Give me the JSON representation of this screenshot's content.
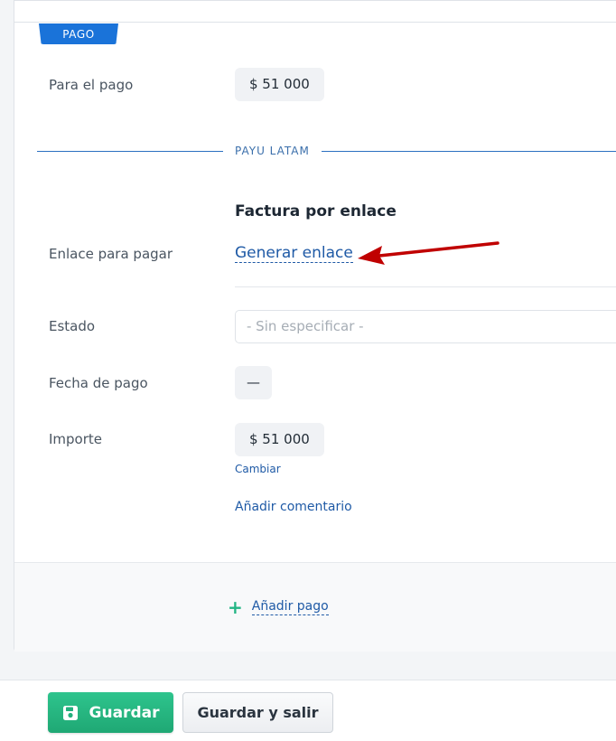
{
  "payment": {
    "badge": "PAGO",
    "for_payment_label": "Para el pago",
    "for_payment_value": "$ 51 000"
  },
  "section": {
    "divider_label": "PAYU LATAM",
    "invoice_title": "Factura por enlace",
    "link_label": "Enlace para pagar",
    "link_action": "Generar enlace",
    "status_label": "Estado",
    "status_placeholder": "- Sin especificar -",
    "date_label": "Fecha de pago",
    "date_value": "—",
    "amount_label": "Importe",
    "amount_value": "$ 51 000",
    "change_link": "Cambiar",
    "comment_link": "Añadir comentario"
  },
  "footer": {
    "add_payment": "Añadir pago"
  },
  "actions": {
    "save": "Guardar",
    "save_exit": "Guardar y salir"
  },
  "colors": {
    "accent_blue": "#1a73d9",
    "save_green": "#23b584",
    "annotation_arrow": "#c00000"
  }
}
